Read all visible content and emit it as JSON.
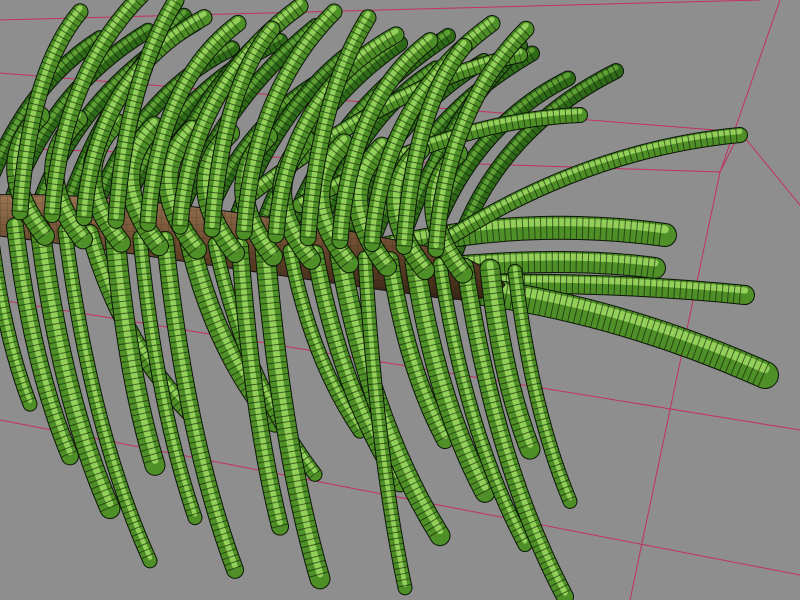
{
  "viewport": {
    "background_color": "#8e8e8e",
    "wireframe_color": "#111111",
    "bounding_box_color": "#c8285a"
  },
  "model": {
    "stem_color": "#6b4a2e",
    "stem_highlight_color": "#9a7552",
    "needle_dark_color": "#1f4a12",
    "needle_mid_color": "#4f8f27",
    "needle_light_color": "#b8f07a"
  }
}
